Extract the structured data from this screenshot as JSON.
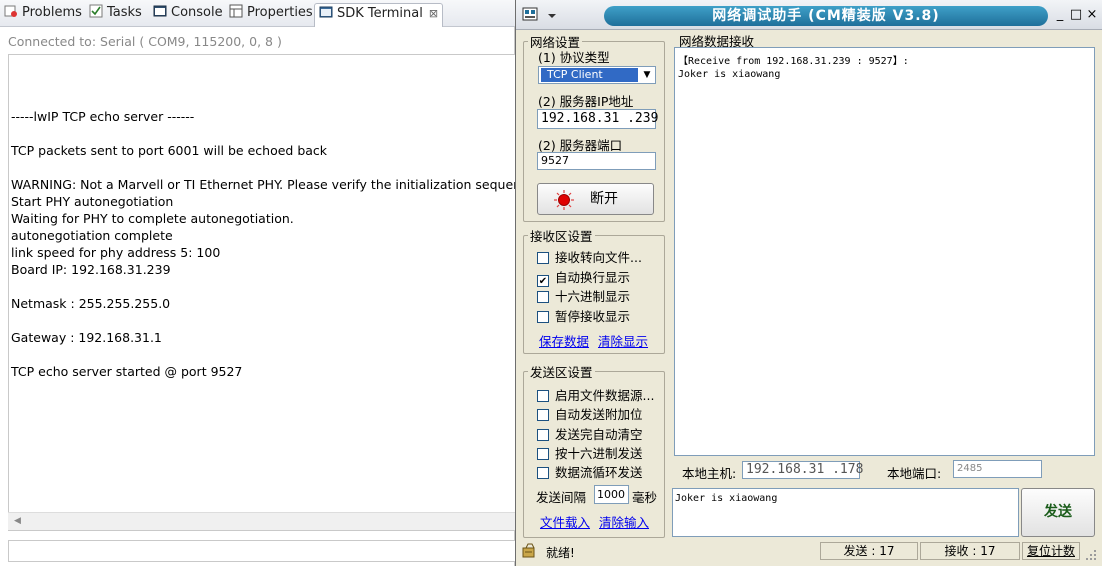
{
  "eclipse": {
    "tabs": [
      {
        "label": "Problems",
        "icon": "problems-icon"
      },
      {
        "label": "Tasks",
        "icon": "tasks-icon"
      },
      {
        "label": "Console",
        "icon": "console-icon"
      },
      {
        "label": "Properties",
        "icon": "properties-icon"
      },
      {
        "label": "SDK Terminal",
        "icon": "terminal-icon",
        "close": "⊠"
      }
    ],
    "connection": "Connected to: Serial (  COM9, 115200, 0, 8 )",
    "console_lines": [
      "-----lwIP TCP echo server ------",
      "TCP packets sent to port 6001 will be echoed back",
      "WARNING: Not a Marvell or TI Ethernet PHY. Please verify the initialization sequence",
      "Start PHY autonegotiation",
      "Waiting for PHY to complete autonegotiation.",
      "autonegotiation complete",
      "link speed for phy address 5: 100",
      "Board IP: 192.168.31.239",
      "Netmask : 255.255.255.0",
      "Gateway : 192.168.31.1",
      "TCP echo server started @ port 9527"
    ]
  },
  "netassist": {
    "title": "网络调试助手 (CM精装版 V3.8)",
    "window_buttons": {
      "minimize": "_",
      "maximize": "□",
      "close": "×"
    },
    "net_settings": {
      "legend": "网络设置",
      "protocol_label": "(1) 协议类型",
      "protocol_value": "TCP Client",
      "ip_label": "(2) 服务器IP地址",
      "ip_value": "192.168.31 .239",
      "port_label": "(2) 服务器端口",
      "port_value": "9527",
      "disconnect_label": "断开"
    },
    "recv_settings": {
      "legend": "接收区设置",
      "options": [
        {
          "label": "接收转向文件...",
          "checked": false
        },
        {
          "label": "自动换行显示",
          "checked": true
        },
        {
          "label": "十六进制显示",
          "checked": false
        },
        {
          "label": "暂停接收显示",
          "checked": false
        }
      ],
      "save_link": "保存数据",
      "clear_link": "清除显示"
    },
    "send_settings": {
      "legend": "发送区设置",
      "options": [
        {
          "label": "启用文件数据源...",
          "checked": false
        },
        {
          "label": "自动发送附加位",
          "checked": false
        },
        {
          "label": "发送完自动清空",
          "checked": false
        },
        {
          "label": "按十六进制发送",
          "checked": false
        },
        {
          "label": "数据流循环发送",
          "checked": false
        }
      ],
      "interval_label": "发送间隔",
      "interval_value": "1000",
      "interval_unit": "毫秒",
      "load_link": "文件载入",
      "clear_input_link": "清除输入"
    },
    "recv_panel": {
      "legend": "网络数据接收",
      "header_line": "【Receive from 192.168.31.239 : 9527】:",
      "body_line": "Joker is xiaowang"
    },
    "local_host_label": "本地主机:",
    "local_host_value": "192.168.31 .178",
    "local_port_label": "本地端口:",
    "local_port_value": "2485",
    "send_text": "Joker is xiaowang",
    "send_button": "发送",
    "status": {
      "ready": "就绪!",
      "sent_label": "发送 : 17",
      "recv_label": "接收 : 17",
      "reset_label": "复位计数"
    }
  }
}
